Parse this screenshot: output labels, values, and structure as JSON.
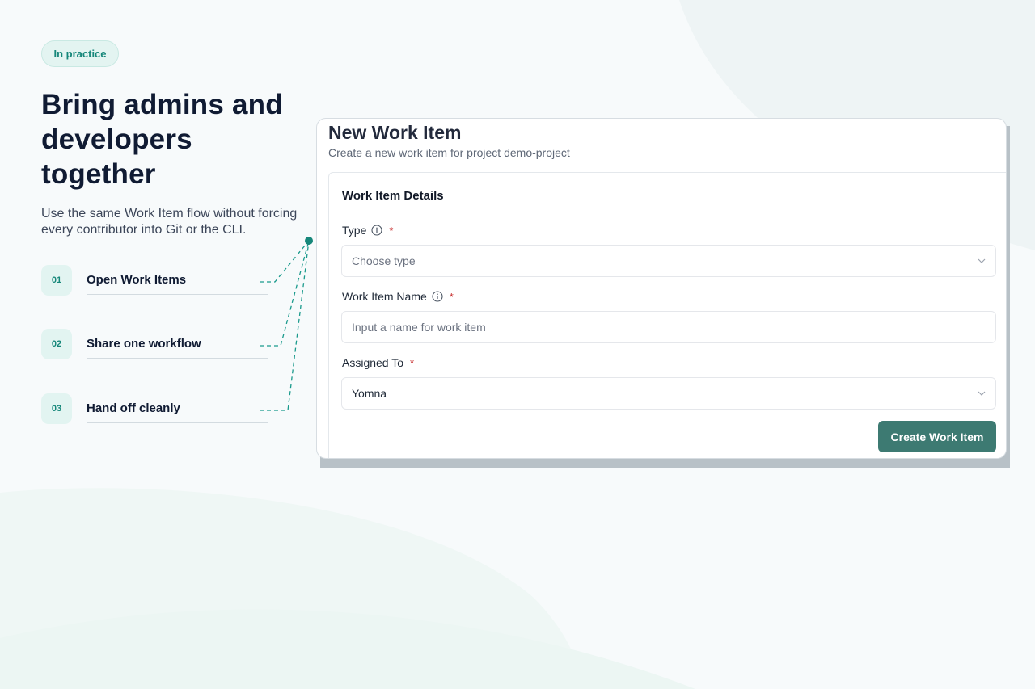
{
  "badge": "In practice",
  "headline": "Bring admins and developers together",
  "subtext": "Use the same Work Item flow without forcing every contributor into Git or the CLI.",
  "steps": [
    {
      "num": "01",
      "label": "Open Work Items"
    },
    {
      "num": "02",
      "label": "Share one workflow"
    },
    {
      "num": "03",
      "label": "Hand off cleanly"
    }
  ],
  "form": {
    "title": "New Work Item",
    "subtitle": "Create a new work item for project demo-project",
    "section_title": "Work Item Details",
    "type_label": "Type",
    "type_placeholder": "Choose type",
    "name_label": "Work Item Name",
    "name_placeholder": "Input a name for work item",
    "assigned_label": "Assigned To",
    "assigned_value": "Yomna",
    "required_mark": "*",
    "submit_label": "Create Work Item"
  },
  "colors": {
    "accent": "#16877a",
    "button": "#3d7a72",
    "required": "#c62828"
  }
}
